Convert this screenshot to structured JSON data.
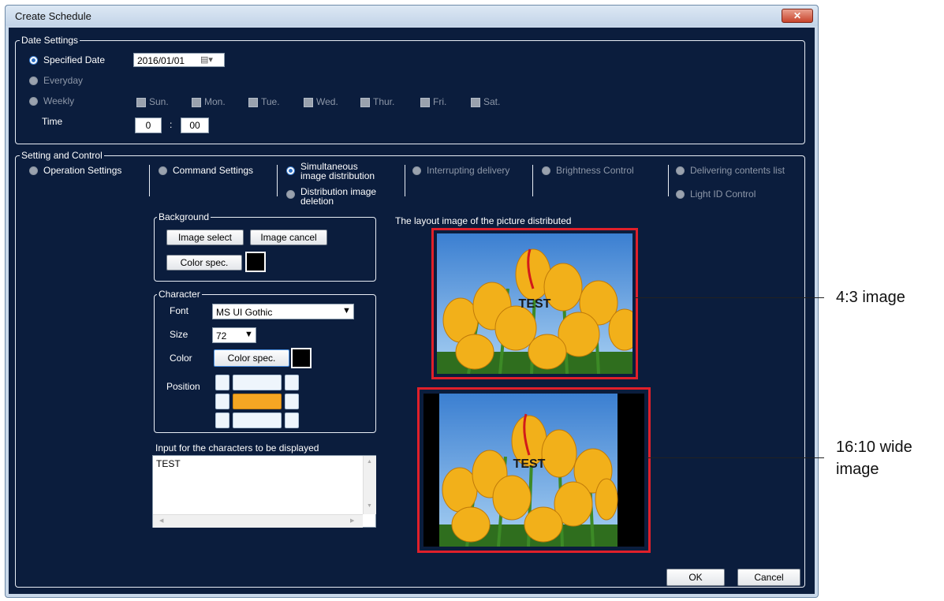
{
  "window": {
    "title": "Create Schedule",
    "close_icon": "close-icon"
  },
  "date_settings": {
    "legend": "Date Settings",
    "specified_date_label": "Specified Date",
    "date_value": "2016/01/01",
    "everyday_label": "Everyday",
    "weekly_label": "Weekly",
    "days": [
      "Sun.",
      "Mon.",
      "Tue.",
      "Wed.",
      "Thur.",
      "Fri.",
      "Sat."
    ],
    "time_label": "Time",
    "hour": "0",
    "sep": ":",
    "minute": "00"
  },
  "setting_control": {
    "legend": "Setting and Control",
    "options": {
      "operation": "Operation Settings",
      "command": "Command Settings",
      "simul_1": "Simultaneous",
      "simul_2": "image distribution",
      "deletion_1": "Distribution image",
      "deletion_2": "deletion",
      "interrupting": "Interrupting delivery",
      "brightness": "Brightness Control",
      "delivering": "Delivering contents list",
      "light_id": "Light ID Control"
    },
    "background": {
      "legend": "Background",
      "image_select": "Image select",
      "image_cancel": "Image cancel",
      "color_spec": "Color spec."
    },
    "character": {
      "legend": "Character",
      "font_label": "Font",
      "font_value": "MS UI Gothic",
      "size_label": "Size",
      "size_value": "72",
      "color_label": "Color",
      "color_spec": "Color spec.",
      "position_label": "Position",
      "position_selected": "middle-center"
    },
    "input_label": "Input for the characters to be displayed",
    "input_text": "TEST",
    "layout_label": "The layout image of the picture distributed",
    "overlay_text": "TEST"
  },
  "buttons": {
    "ok": "OK",
    "cancel": "Cancel"
  },
  "callouts": {
    "a": "4:3 image",
    "b1": "16:10 wide",
    "b2": "image"
  },
  "colors": {
    "panel_bg": "#0b1d3d",
    "highlight": "#e0202a",
    "position_selected": "#f5a623"
  }
}
